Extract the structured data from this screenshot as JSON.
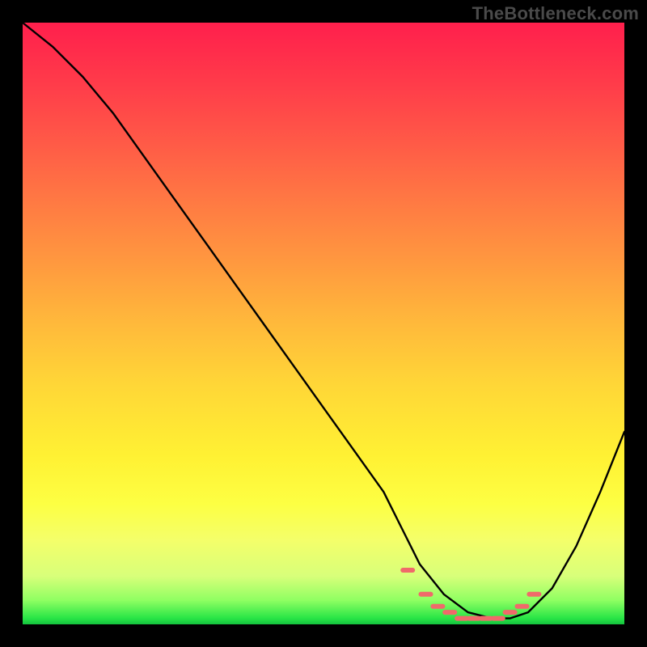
{
  "watermark": "TheBottleneck.com",
  "chart_data": {
    "type": "line",
    "title": "",
    "xlabel": "",
    "ylabel": "",
    "xlim": [
      0,
      100
    ],
    "ylim": [
      0,
      100
    ],
    "series": [
      {
        "name": "bottleneck-curve",
        "x": [
          0,
          5,
          10,
          15,
          20,
          25,
          30,
          35,
          40,
          45,
          50,
          55,
          60,
          63,
          66,
          70,
          74,
          78,
          81,
          84,
          88,
          92,
          96,
          100
        ],
        "values": [
          100,
          96,
          91,
          85,
          78,
          71,
          64,
          57,
          50,
          43,
          36,
          29,
          22,
          16,
          10,
          5,
          2,
          1,
          1,
          2,
          6,
          13,
          22,
          32
        ]
      }
    ],
    "markers": {
      "name": "optimal-range",
      "x": [
        64,
        67,
        69,
        71,
        73,
        75,
        77,
        79,
        81,
        83,
        85
      ],
      "values": [
        9,
        5,
        3,
        2,
        1,
        1,
        1,
        1,
        2,
        3,
        5
      ],
      "color": "#f06a6a"
    },
    "gradient_stops": [
      {
        "pos": 0,
        "color": "#ff1f4c"
      },
      {
        "pos": 50,
        "color": "#ffb93b"
      },
      {
        "pos": 80,
        "color": "#fdff43"
      },
      {
        "pos": 100,
        "color": "#14c23e"
      }
    ]
  }
}
